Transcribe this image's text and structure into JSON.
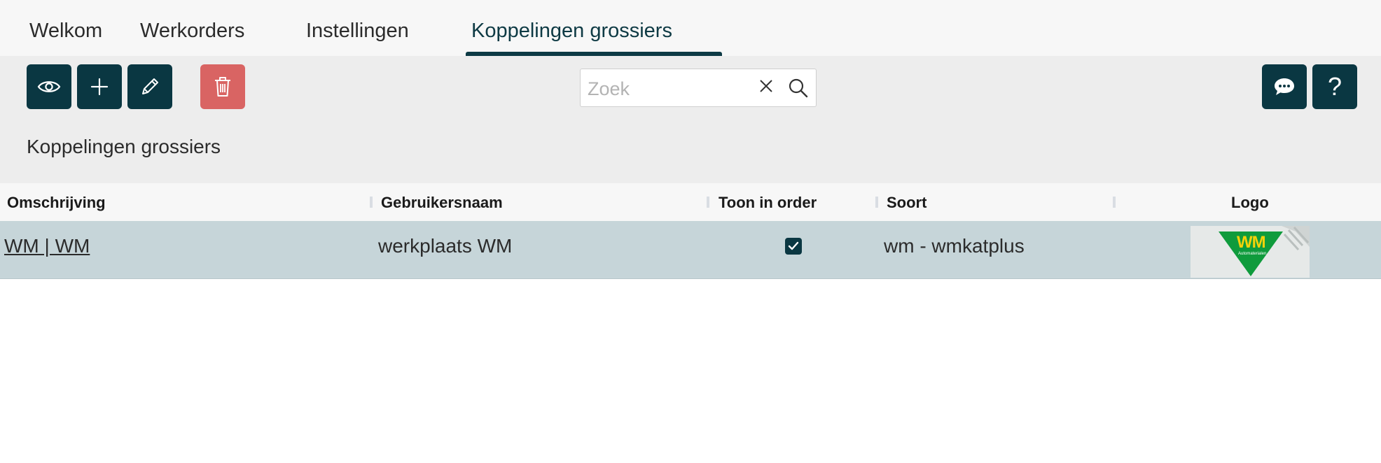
{
  "tabs": [
    {
      "label": "Welkom"
    },
    {
      "label": "Werkorders"
    },
    {
      "label": "Instellingen"
    },
    {
      "label": "Koppelingen grossiers",
      "active": true
    }
  ],
  "toolbar": {
    "buttons": [
      "eye-icon",
      "plus-icon",
      "pencil-icon",
      "trash-icon"
    ],
    "right_buttons": [
      "chat-icon",
      "question-icon"
    ],
    "help_glyph": "?"
  },
  "search": {
    "placeholder": "Zoek",
    "value": ""
  },
  "page": {
    "title": "Koppelingen grossiers"
  },
  "table": {
    "columns": [
      "Omschrijving",
      "Gebruikersnaam",
      "Toon in order",
      "Soort",
      "Logo"
    ],
    "rows": [
      {
        "omschrijving": "WM | WM",
        "gebruikersnaam": "werkplaats WM",
        "toon_in_order": true,
        "soort": "wm - wmkatplus",
        "logo": {
          "text": "WM",
          "subtext": "Automaterialen"
        }
      }
    ]
  },
  "colors": {
    "primary": "#0a3742",
    "danger": "#d96463",
    "row_highlight": "#c6d5d9",
    "logo_green": "#0f9b3c",
    "logo_yellow": "#f4d20a"
  }
}
